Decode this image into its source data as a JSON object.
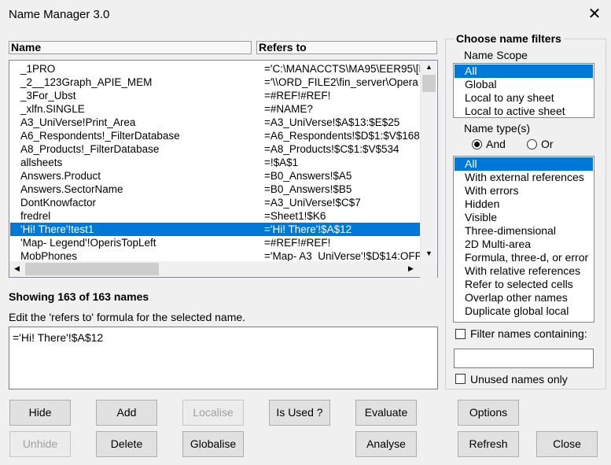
{
  "window": {
    "title": "Name Manager 3.0",
    "close_glyph": "✕"
  },
  "list": {
    "headers": {
      "name": "Name",
      "refers_to": "Refers to"
    },
    "rows": [
      {
        "name": "_1PRO",
        "refers_to": "='C:\\MANACCTS\\MA95\\EER95\\[E"
      },
      {
        "name": "_2__123Graph_APIE_MEM",
        "refers_to": "='\\\\ORD_FILE2\\fin_server\\Opera"
      },
      {
        "name": "_3For_Ubst",
        "refers_to": "=#REF!#REF!"
      },
      {
        "name": "_xlfn.SINGLE",
        "refers_to": "=#NAME?"
      },
      {
        "name": "A3_UniVerse!Print_Area",
        "refers_to": "=A3_UniVerse!$A$13:$E$25"
      },
      {
        "name": "A6_Respondents!_FilterDatabase",
        "refers_to": "=A6_Respondents!$D$1:$V$168"
      },
      {
        "name": "A8_Products!_FilterDatabase",
        "refers_to": "=A8_Products!$C$1:$V$534"
      },
      {
        "name": "allsheets",
        "refers_to": "=!$A$1"
      },
      {
        "name": "Answers.Product",
        "refers_to": "=B0_Answers!$A5"
      },
      {
        "name": "Answers.SectorName",
        "refers_to": "=B0_Answers!$B5"
      },
      {
        "name": "DontKnowfactor",
        "refers_to": "=A3_UniVerse!$C$7"
      },
      {
        "name": "fredrel",
        "refers_to": "=Sheet1!$K6"
      },
      {
        "name": "'Hi! There'!test1",
        "refers_to": "='Hi! There'!$A$12",
        "selected": true
      },
      {
        "name": "'Map- Legend'!OperisTopLeft",
        "refers_to": "=#REF!#REF!"
      },
      {
        "name": "MobPhones",
        "refers_to": "='Map- A3_UniVerse'!$D$14:OFF"
      }
    ],
    "scroll_up": "▲",
    "scroll_down": "▼",
    "scroll_left": "◀",
    "scroll_right": "▶"
  },
  "status": {
    "showing": "Showing 163 of 163 names"
  },
  "editor": {
    "label": "Edit the 'refers to' formula for the selected name.",
    "value": "='Hi! There'!$A$12"
  },
  "filters": {
    "legend": "Choose name filters",
    "scope_label": "Name Scope",
    "scope_options": [
      "All",
      "Global",
      "Local to any sheet",
      "Local to active sheet"
    ],
    "scope_selected": "All",
    "type_label": "Name type(s)",
    "and_label": "And",
    "or_label": "Or",
    "and_selected": true,
    "type_options": [
      "All",
      "With external references",
      "With errors",
      "Hidden",
      "Visible",
      "Three-dimensional",
      "2D Multi-area",
      "Formula, three-d, or error",
      "With relative references",
      "Refer to selected cells",
      "Overlap other names",
      "Duplicate global local"
    ],
    "type_selected": "All",
    "containing_label": "Filter names containing:",
    "containing_value": "",
    "unused_label": "Unused names only"
  },
  "buttons": {
    "hide": "Hide",
    "add": "Add",
    "localise": "Localise",
    "is_used": "Is Used ?",
    "evaluate": "Evaluate",
    "options": "Options",
    "unhide": "Unhide",
    "delete": "Delete",
    "globalise": "Globalise",
    "analyse": "Analyse",
    "refresh": "Refresh",
    "close": "Close"
  }
}
